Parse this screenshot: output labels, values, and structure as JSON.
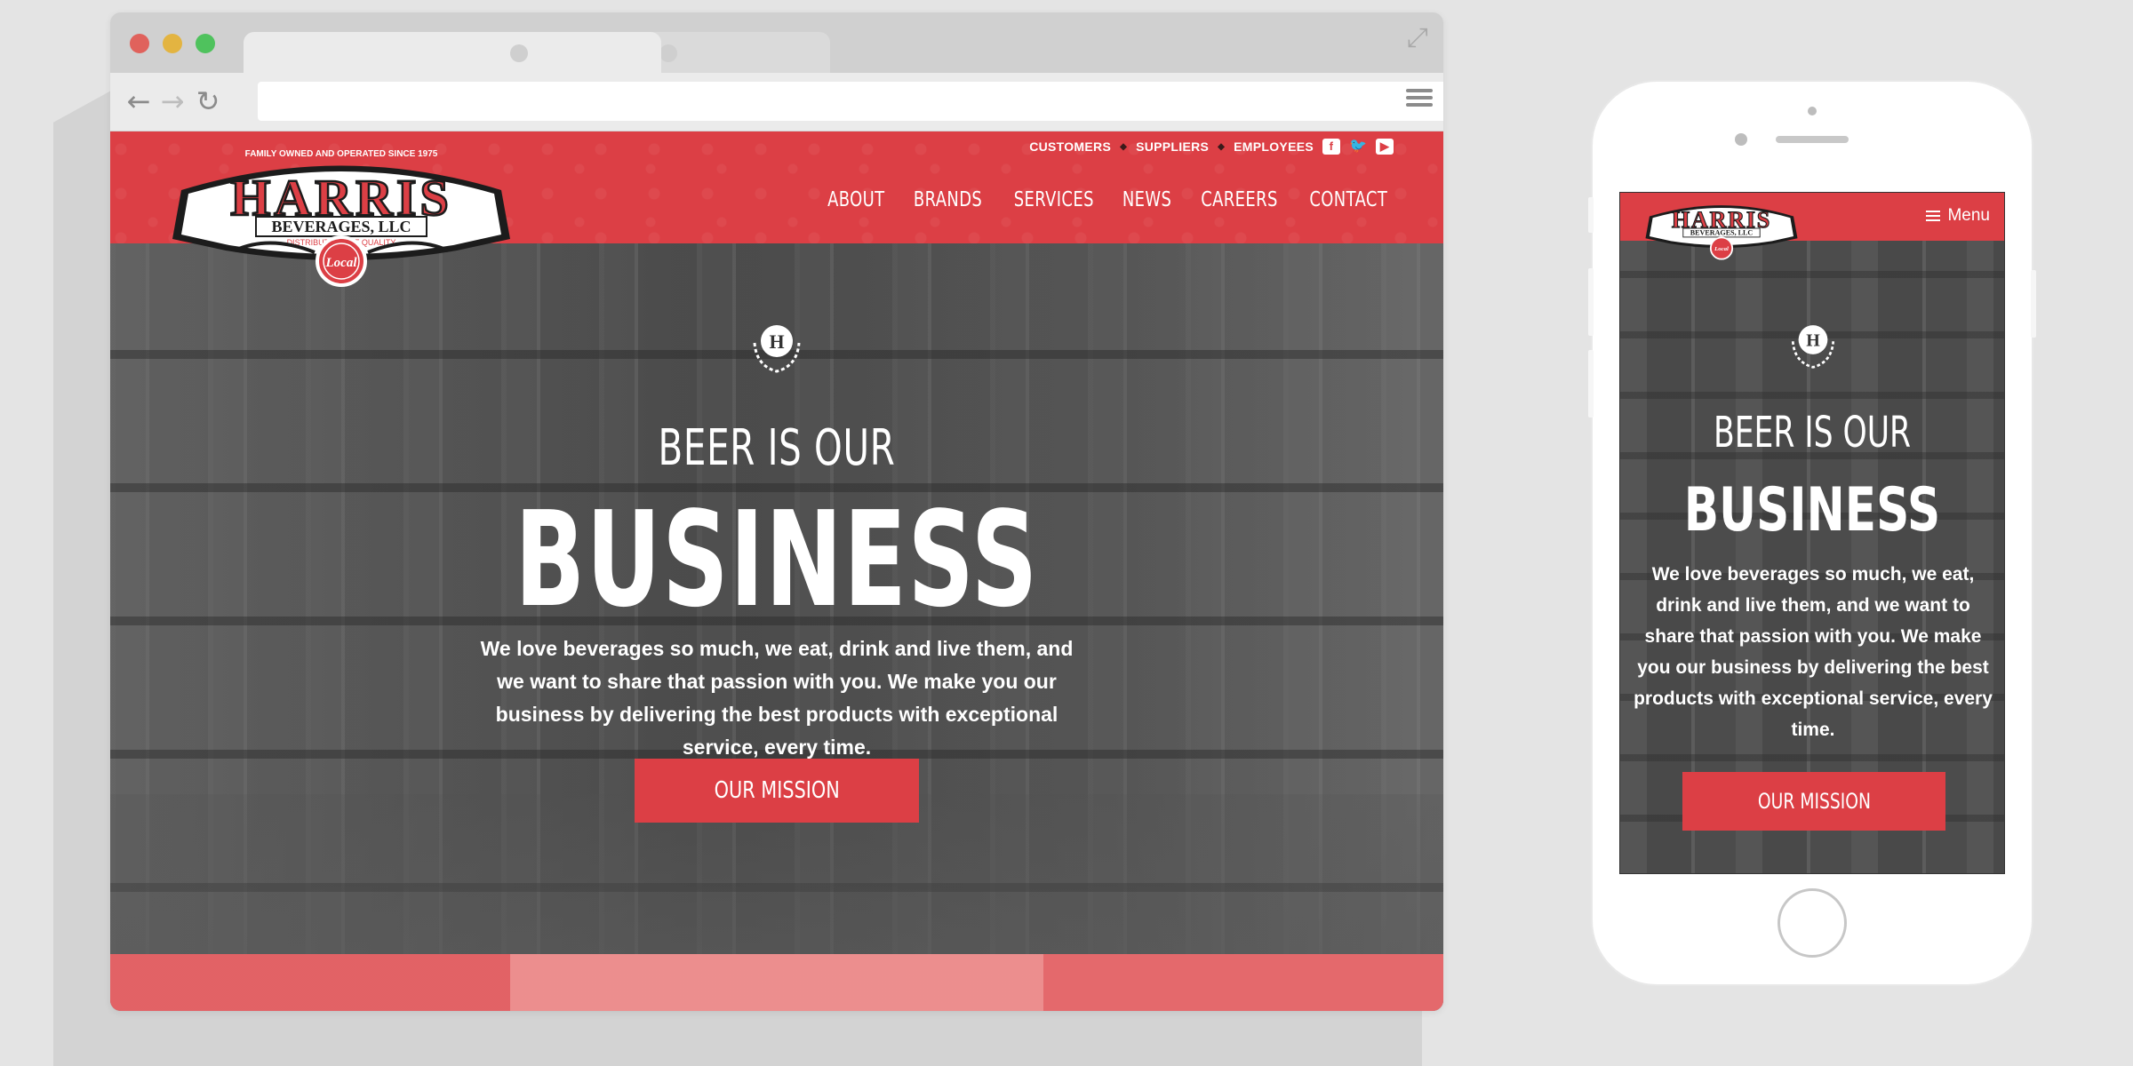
{
  "browser": {
    "window_controls": [
      "close",
      "minimize",
      "maximize"
    ],
    "icons": [
      "back-arrow-icon",
      "forward-arrow-icon",
      "reload-icon",
      "bookmark-star-icon",
      "menu-icon",
      "expand-icon"
    ]
  },
  "site": {
    "brand": {
      "name": "HARRIS",
      "subtitle": "BEVERAGES, LLC",
      "tagline": "FAMILY OWNED AND OPERATED SINCE 1975",
      "tagline2": "DISTRIBUTORS OF QUALITY",
      "seal_text": "Local",
      "crest_letter": "H"
    },
    "utility_links": [
      "CUSTOMERS",
      "SUPPLIERS",
      "EMPLOYEES"
    ],
    "social": [
      "facebook-icon",
      "twitter-icon",
      "youtube-icon"
    ],
    "nav": [
      "ABOUT",
      "BRANDS",
      "SERVICES",
      "NEWS",
      "CAREERS",
      "CONTACT"
    ],
    "hero": {
      "pre_title": "BEER IS OUR",
      "title": "BUSINESS",
      "text": "We love beverages so much, we eat, drink and live them, and we want to share that passion with you. We make you our business by delivering the best products with exceptional service, every time.",
      "button": "OUR MISSION"
    }
  },
  "mobile": {
    "menu_label": "Menu"
  },
  "colors": {
    "brand_red": "#dc3f45",
    "white": "#ffffff",
    "dark_overlay": "#3c3c3c"
  }
}
